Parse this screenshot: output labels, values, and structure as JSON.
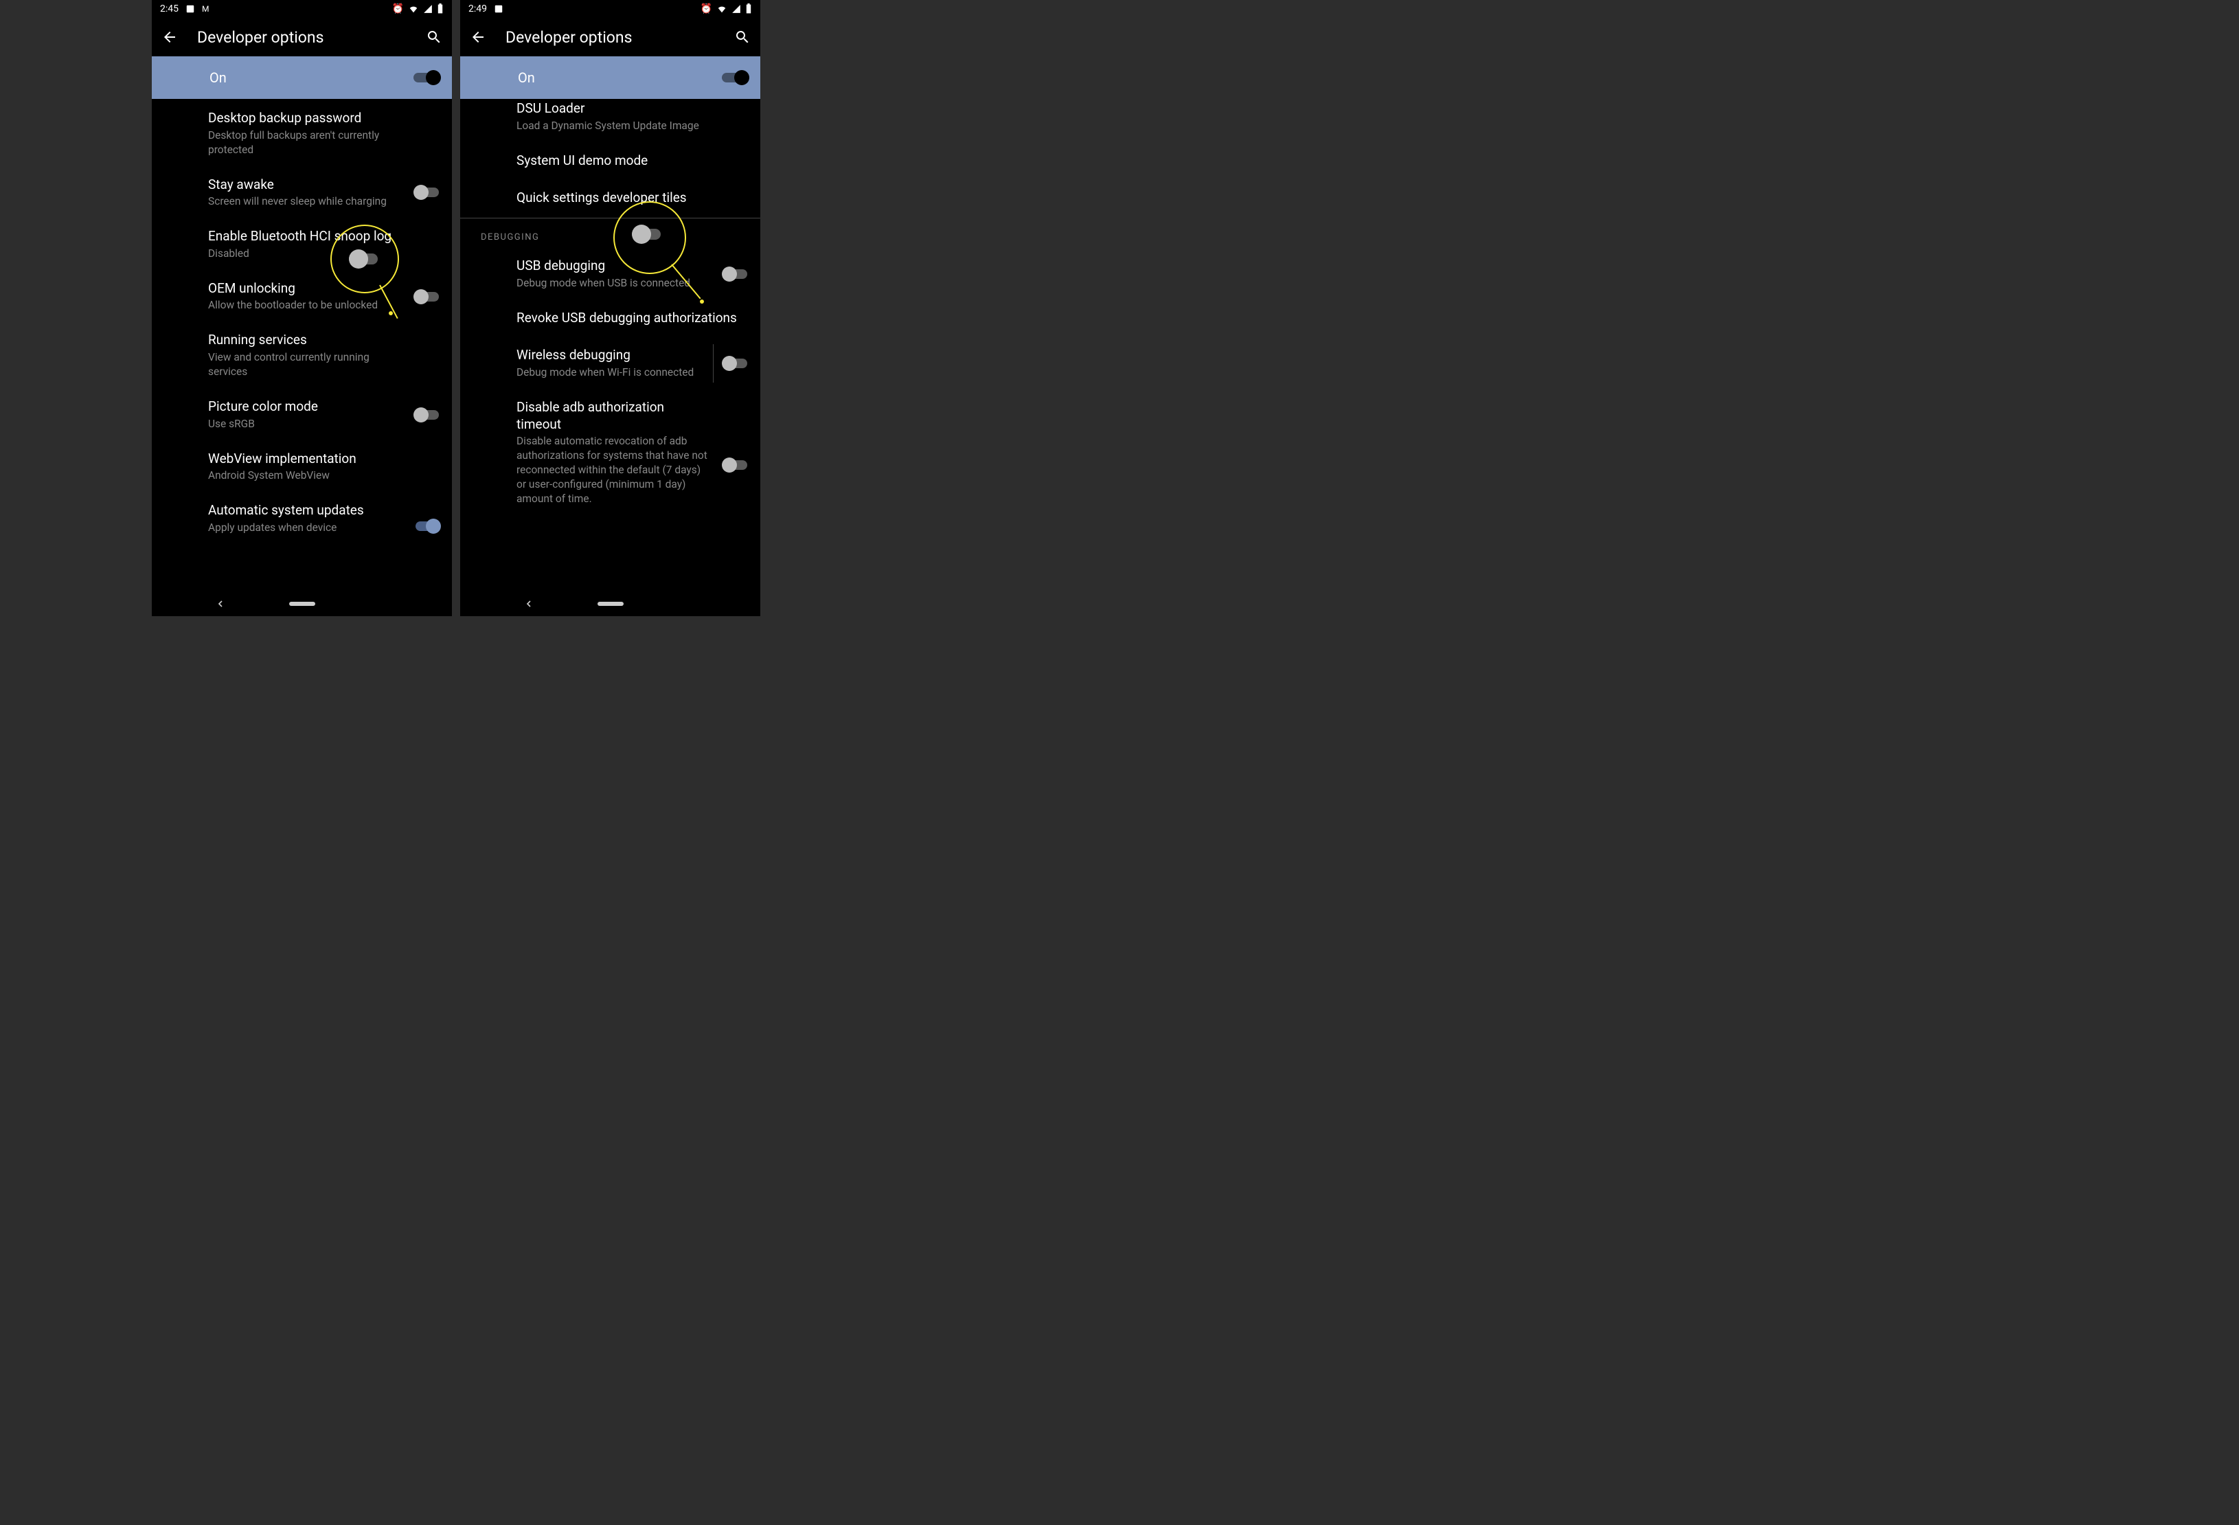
{
  "colors": {
    "accent": "#7d95bf",
    "highlight": "#f5e838"
  },
  "phones": [
    {
      "status": {
        "time": "2:45",
        "iconsLeft": [
          "📷",
          "M"
        ],
        "iconsRight": [
          "⏰",
          "wifi",
          "signal",
          "battery"
        ]
      },
      "title": "Developer options",
      "master": {
        "label": "On",
        "on": true
      },
      "items": [
        {
          "id": "desktop-backup",
          "title": "Desktop backup password",
          "sub": "Desktop full backups aren't currently protected",
          "toggle": null
        },
        {
          "id": "stay-awake",
          "title": "Stay awake",
          "sub": "Screen will never sleep while charging",
          "toggle": false
        },
        {
          "id": "bt-hci",
          "title": "Enable Bluetooth HCI snoop log",
          "sub": "Disabled",
          "toggle": null
        },
        {
          "id": "oem-unlocking",
          "title": "OEM unlocking",
          "sub": "Allow the bootloader to be unlocked",
          "toggle": false
        },
        {
          "id": "running-services",
          "title": "Running services",
          "sub": "View and control currently running services",
          "toggle": null
        },
        {
          "id": "picture-color",
          "title": "Picture color mode",
          "sub": "Use sRGB",
          "toggle": false
        },
        {
          "id": "webview",
          "title": "WebView implementation",
          "sub": "Android System WebView",
          "toggle": null
        },
        {
          "id": "auto-updates",
          "title": "Automatic system updates",
          "sub": "Apply updates when device",
          "toggle": true
        }
      ]
    },
    {
      "status": {
        "time": "2:49",
        "iconsLeft": [
          "📷"
        ],
        "iconsRight": [
          "⏰",
          "wifi",
          "signal",
          "battery"
        ]
      },
      "title": "Developer options",
      "master": {
        "label": "On",
        "on": true
      },
      "pre_items": [
        {
          "id": "dsu-loader",
          "title": "DSU Loader",
          "sub": "Load a Dynamic System Update Image",
          "toggle": null
        },
        {
          "id": "sysui-demo",
          "title": "System UI demo mode",
          "sub": "",
          "toggle": null
        },
        {
          "id": "qs-tiles",
          "title": "Quick settings developer tiles",
          "sub": "",
          "toggle": null
        }
      ],
      "section": "Debugging",
      "items": [
        {
          "id": "usb-debug",
          "title": "USB debugging",
          "sub": "Debug mode when USB is connected",
          "toggle": false
        },
        {
          "id": "revoke-usb",
          "title": "Revoke USB debugging authorizations",
          "sub": "",
          "toggle": null
        },
        {
          "id": "wireless-debug",
          "title": "Wireless debugging",
          "sub": "Debug mode when Wi-Fi is connected",
          "toggle": false,
          "divider": true
        },
        {
          "id": "adb-timeout",
          "title": "Disable adb authorization timeout",
          "sub": "Disable automatic revocation of adb authorizations for systems that have not reconnected within the default (7 days) or user-configured (minimum 1 day) amount of time.",
          "toggle": false
        }
      ]
    }
  ]
}
